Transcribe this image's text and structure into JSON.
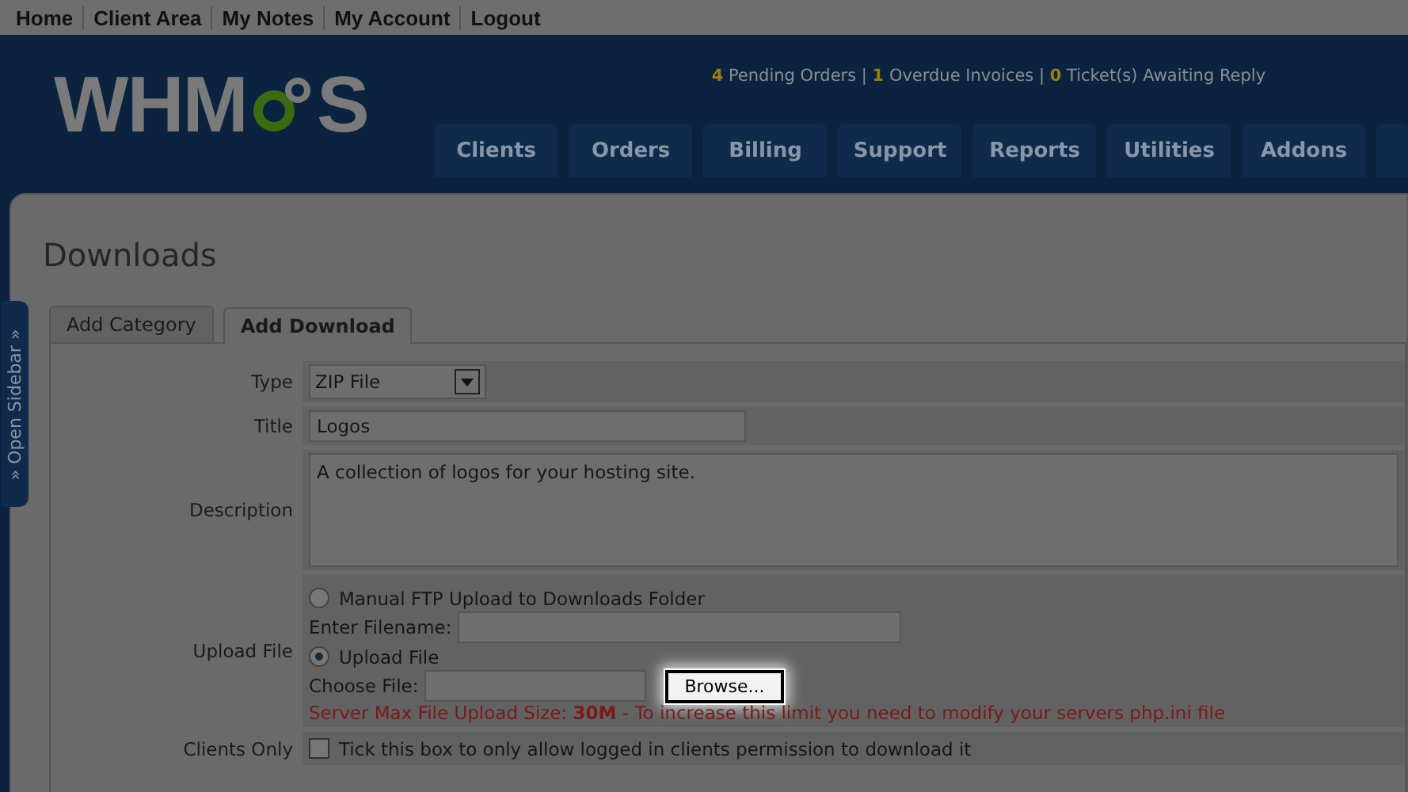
{
  "top_links": [
    "Home",
    "Client Area",
    "My Notes",
    "My Account",
    "Logout"
  ],
  "logo": {
    "before": "WHM",
    "after": "S"
  },
  "stats": "**4** Pending Orders | **1** Overdue Invoices | **0** Ticket(s) Awaiting Reply",
  "nav_tabs": [
    "Clients",
    "Orders",
    "Billing",
    "Support",
    "Reports",
    "Utilities",
    "Addons"
  ],
  "sidebar_toggle": "» Open Sidebar »",
  "page_title": "Downloads",
  "tabs": [
    {
      "label": "Add Category",
      "selected": false
    },
    {
      "label": "Add Download",
      "selected": true
    }
  ],
  "form": {
    "type": {
      "label": "Type",
      "value": "ZIP File"
    },
    "title": {
      "label": "Title",
      "value": "Logos"
    },
    "description": {
      "label": "Description",
      "value": "A collection of logos for your hosting site."
    },
    "upload": {
      "label": "Upload File",
      "options": [
        {
          "label": "Manual FTP Upload to Downloads Folder",
          "selected": false,
          "field_label": "Enter Filename:"
        },
        {
          "label": "Upload File",
          "selected": true,
          "field_label": "Choose File:",
          "button": "Browse..."
        }
      ],
      "note": "Server Max File Upload Size: **30M** - To increase this limit you need to modify your servers php.ini file"
    },
    "clients_only": {
      "label": "Clients Only",
      "checked": false,
      "text": "Tick this box to only allow logged in clients permission to download it"
    }
  }
}
